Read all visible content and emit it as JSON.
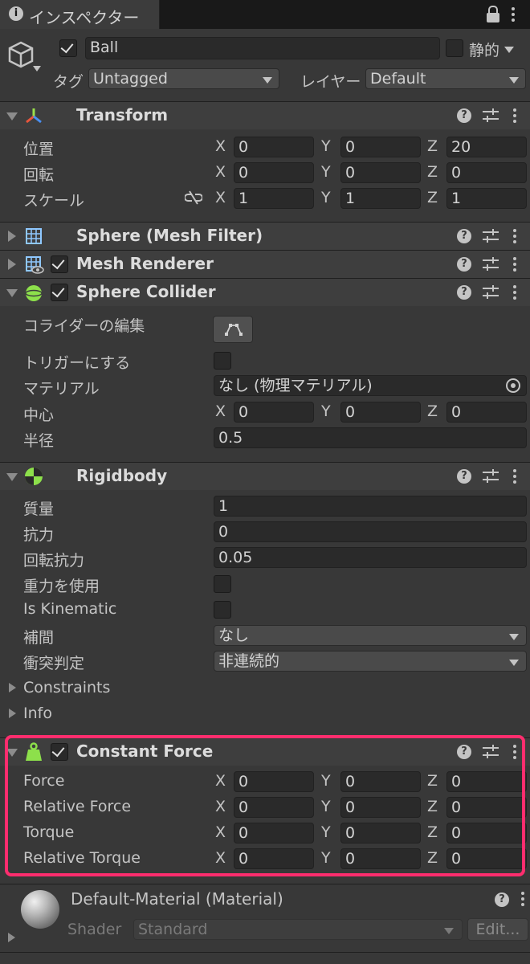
{
  "window": {
    "tab_label": "インスペクター"
  },
  "object": {
    "name": "Ball",
    "static_label": "静的",
    "tag_label": "タグ",
    "tag_value": "Untagged",
    "layer_label": "レイヤー",
    "layer_value": "Default"
  },
  "axes": {
    "x": "X",
    "y": "Y",
    "z": "Z"
  },
  "transform": {
    "title": "Transform",
    "rows": [
      {
        "label": "位置",
        "x": "0",
        "y": "0",
        "z": "20"
      },
      {
        "label": "回転",
        "x": "0",
        "y": "0",
        "z": "0"
      },
      {
        "label": "スケール",
        "x": "1",
        "y": "1",
        "z": "1"
      }
    ]
  },
  "mesh_filter": {
    "title": "Sphere (Mesh Filter)"
  },
  "mesh_renderer": {
    "title": "Mesh Renderer"
  },
  "sphere_collider": {
    "title": "Sphere Collider",
    "edit_label": "コライダーの編集",
    "trigger_label": "トリガーにする",
    "material_label": "マテリアル",
    "material_value": "なし (物理マテリアル)",
    "center_label": "中心",
    "center": {
      "x": "0",
      "y": "0",
      "z": "0"
    },
    "radius_label": "半径",
    "radius_value": "0.5"
  },
  "rigidbody": {
    "title": "Rigidbody",
    "mass_label": "質量",
    "mass_value": "1",
    "drag_label": "抗力",
    "drag_value": "0",
    "angular_drag_label": "回転抗力",
    "angular_drag_value": "0.05",
    "use_gravity_label": "重力を使用",
    "is_kinematic_label": "Is Kinematic",
    "interpolate_label": "補間",
    "interpolate_value": "なし",
    "collision_label": "衝突判定",
    "collision_value": "非連続的",
    "constraints_label": "Constraints",
    "info_label": "Info"
  },
  "constant_force": {
    "title": "Constant Force",
    "rows": [
      {
        "label": "Force",
        "x": "0",
        "y": "0",
        "z": "0"
      },
      {
        "label": "Relative Force",
        "x": "0",
        "y": "0",
        "z": "0"
      },
      {
        "label": "Torque",
        "x": "0",
        "y": "0",
        "z": "0"
      },
      {
        "label": "Relative Torque",
        "x": "0",
        "y": "0",
        "z": "0"
      }
    ]
  },
  "material": {
    "title": "Default-Material (Material)",
    "shader_label": "Shader",
    "shader_value": "Standard",
    "edit_button": "Edit..."
  },
  "colors": {
    "highlight": "#ff2d6e",
    "background": "#383838",
    "field": "#2a2a2a"
  }
}
